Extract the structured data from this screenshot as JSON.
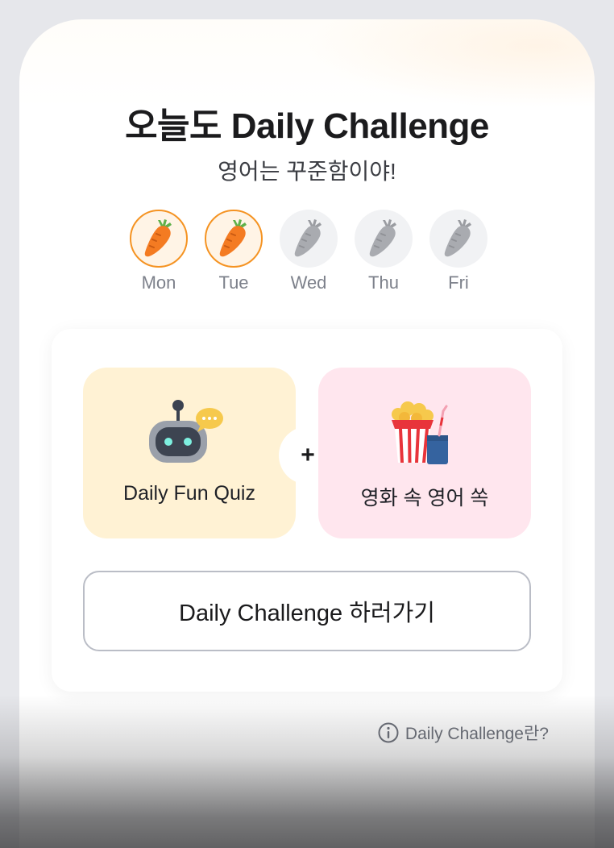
{
  "header": {
    "title": "오늘도 Daily Challenge",
    "subtitle": "영어는 꾸준함이야!"
  },
  "week": {
    "days": [
      {
        "label": "Mon",
        "completed": true,
        "icon": "carrot-icon"
      },
      {
        "label": "Tue",
        "completed": true,
        "icon": "carrot-icon"
      },
      {
        "label": "Wed",
        "completed": false,
        "icon": "carrot-icon"
      },
      {
        "label": "Thu",
        "completed": false,
        "icon": "carrot-icon"
      },
      {
        "label": "Fri",
        "completed": false,
        "icon": "carrot-icon"
      }
    ]
  },
  "challenges": {
    "quiz": {
      "label": "Daily Fun Quiz",
      "icon": "robot-icon"
    },
    "plus": "+",
    "movie": {
      "label": "영화 속 영어 쏙",
      "icon": "popcorn-icon"
    }
  },
  "cta": {
    "label": "Daily Challenge 하러가기"
  },
  "info": {
    "label": "Daily Challenge란?",
    "icon": "info-icon"
  },
  "colors": {
    "accent": "#f59322",
    "quiz_tile": "#fff2d4",
    "movie_tile": "#ffe6ee"
  }
}
